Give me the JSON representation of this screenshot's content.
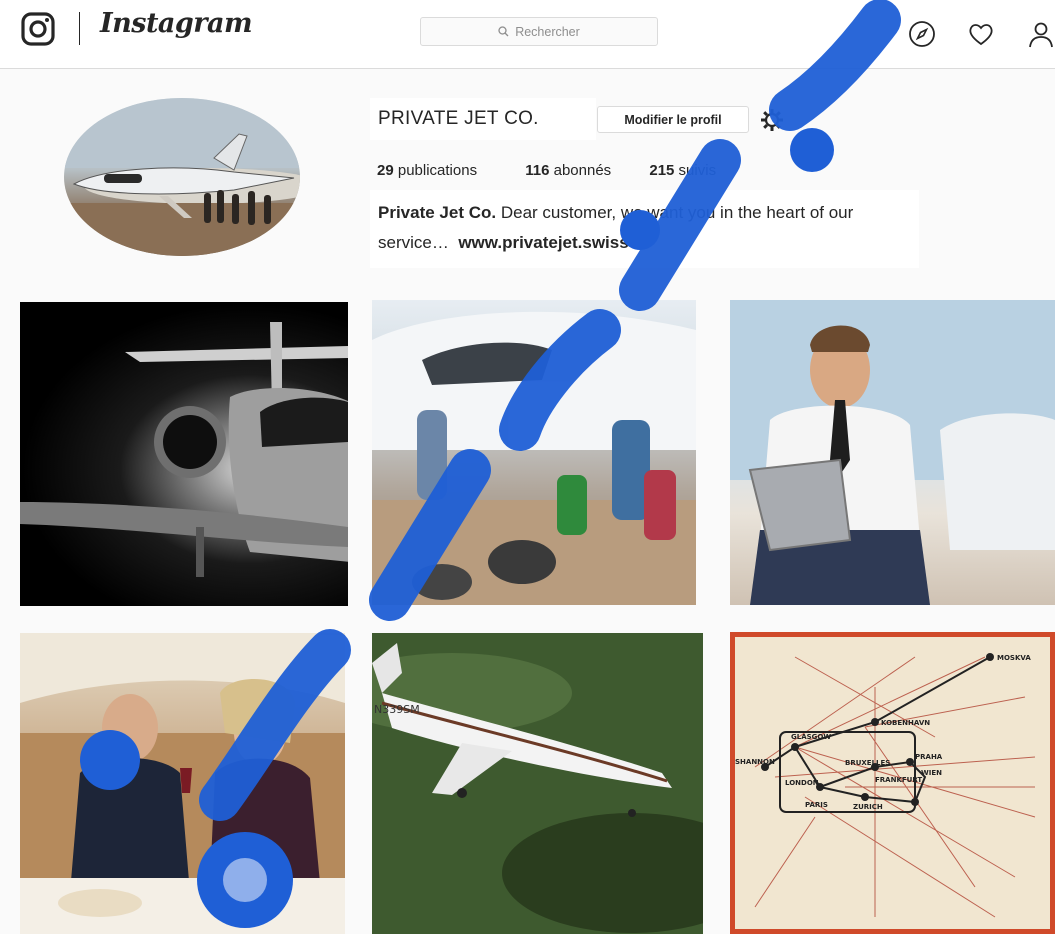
{
  "header": {
    "app_name": "Instagram",
    "search": {
      "placeholder": "Rechercher"
    }
  },
  "profile": {
    "username": "PRIVATE JET CO.",
    "edit_button": "Modifier le profil",
    "stats": [
      {
        "count": "29",
        "label": " publications"
      },
      {
        "count": "116",
        "label": " abonnés"
      },
      {
        "count": "215",
        "label": " suivis"
      }
    ],
    "bio": {
      "name": "Private Jet Co.",
      "text": " Dear customer, we want you in the heart of our service…",
      "link": "www.privatejet.swiss"
    }
  },
  "map_labels": [
    "MOSKVA",
    "KOBENHAVN",
    "GLASGOW",
    "SHANNON",
    "LONDON",
    "PARIS",
    "BRUXELLES",
    "FRANKFURT",
    "PRAHA",
    "WIEN",
    "ZURICH"
  ],
  "tail_number": "N339SM",
  "colors": {
    "accent_map_border": "#d04a2a",
    "watermark": "#1f5fd6"
  }
}
